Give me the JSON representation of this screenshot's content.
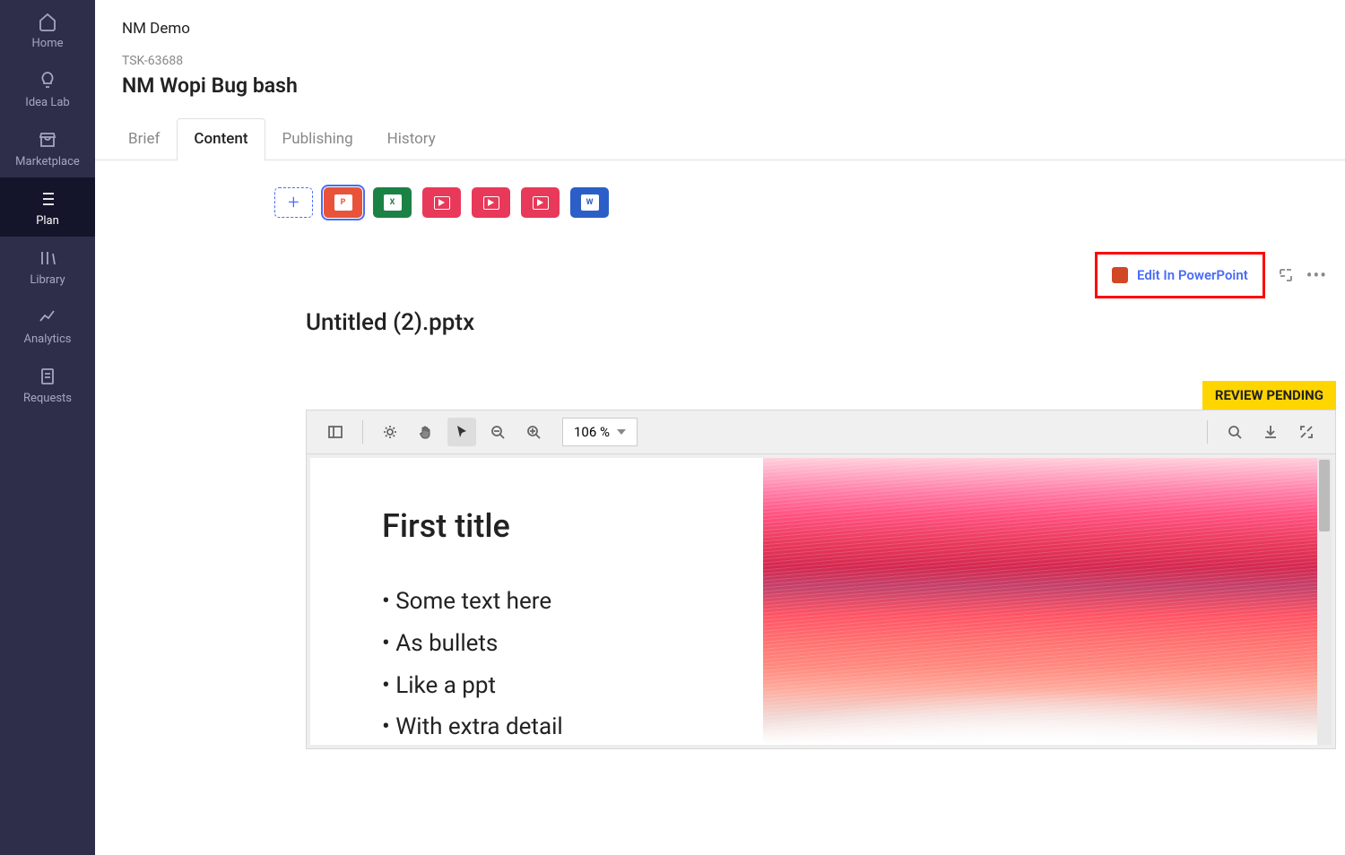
{
  "sidebar": {
    "items": [
      {
        "label": "Home"
      },
      {
        "label": "Idea Lab"
      },
      {
        "label": "Marketplace"
      },
      {
        "label": "Plan"
      },
      {
        "label": "Library"
      },
      {
        "label": "Analytics"
      },
      {
        "label": "Requests"
      }
    ]
  },
  "header": {
    "breadcrumb": "NM Demo",
    "task_id": "TSK-63688",
    "title": "NM Wopi Bug bash"
  },
  "tabs": [
    {
      "label": "Brief"
    },
    {
      "label": "Content"
    },
    {
      "label": "Publishing"
    },
    {
      "label": "History"
    }
  ],
  "actions": {
    "edit_label": "Edit In PowerPoint"
  },
  "document": {
    "filename": "Untitled (2).pptx",
    "status_badge": "REVIEW PENDING"
  },
  "viewer": {
    "zoom": "106 %"
  },
  "slide": {
    "title": "First title",
    "bullets": [
      "Some text here",
      "As bullets",
      "Like a ppt",
      "With extra detail"
    ]
  }
}
